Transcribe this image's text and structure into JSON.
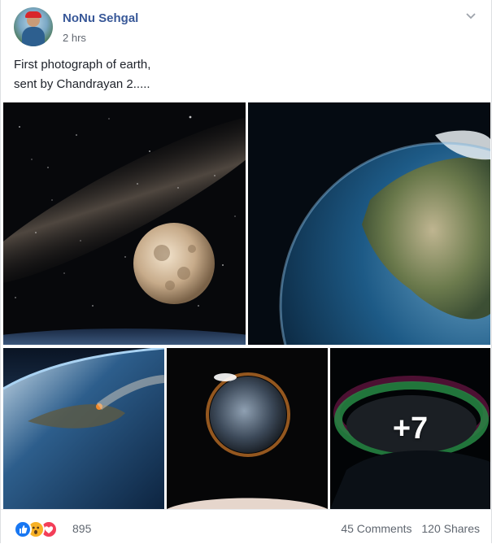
{
  "post": {
    "author": "NoNu Sehgal",
    "time": "2 hrs",
    "text": "First photograph of earth,\nsent by Chandrayan 2.....",
    "more_photos_label": "+7"
  },
  "footer": {
    "reaction_icons": [
      "like-icon",
      "wow-icon",
      "love-icon"
    ],
    "reaction_count": "895",
    "comments": "45 Comments",
    "shares": "120 Shares"
  },
  "colors": {
    "author_link": "#385898",
    "like": "#1877f2",
    "wow": "#f7b125",
    "love": "#f33e58"
  }
}
